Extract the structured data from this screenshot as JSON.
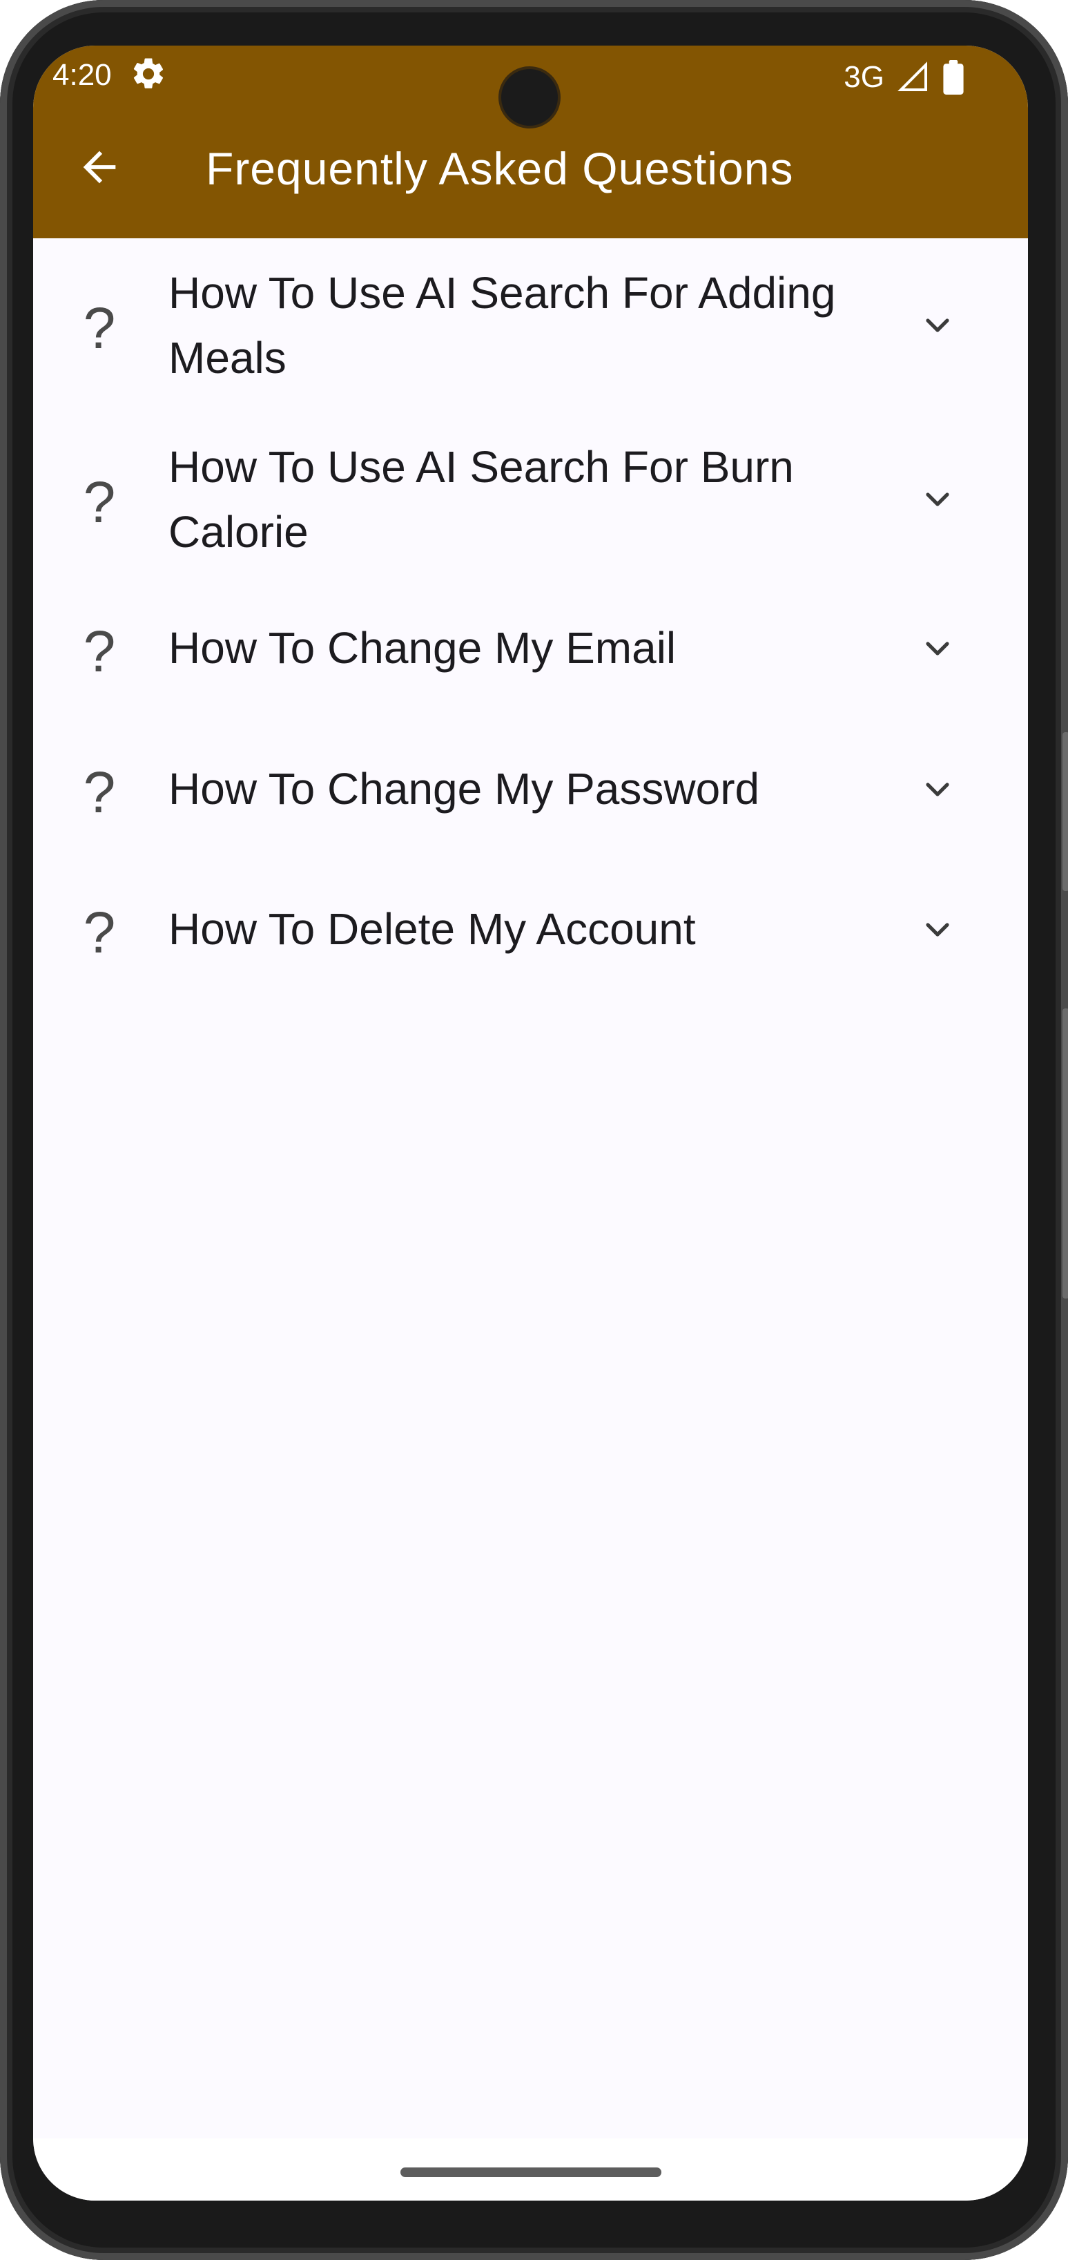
{
  "status_bar": {
    "time": "4:20",
    "network": "3G",
    "icons": [
      "settings-icon",
      "signal-icon",
      "battery-icon"
    ]
  },
  "app_bar": {
    "back_icon": "arrow-back-icon",
    "title": "Frequently Asked Questions",
    "background_color": "#835502"
  },
  "faq": {
    "items": [
      {
        "question": "How To Use AI Search For Adding Meals",
        "icon": "help-icon",
        "expanded": false
      },
      {
        "question": "How To Use AI Search For Burn Calorie",
        "icon": "help-icon",
        "expanded": false
      },
      {
        "question": "How To Change My Email",
        "icon": "help-icon",
        "expanded": false
      },
      {
        "question": "How To Change My Password",
        "icon": "help-icon",
        "expanded": false
      },
      {
        "question": "How To Delete My Account",
        "icon": "help-icon",
        "expanded": false
      }
    ]
  }
}
